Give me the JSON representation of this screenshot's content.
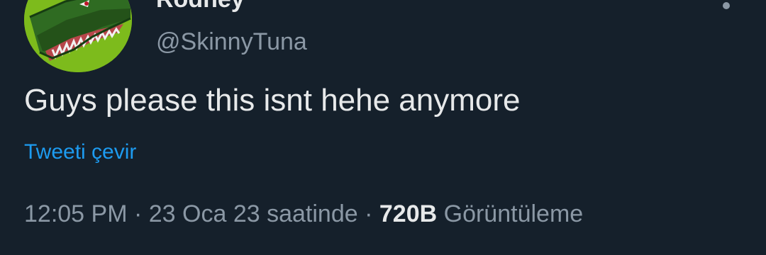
{
  "author": {
    "display_name": "Rodney",
    "handle": "@SkinnyTuna",
    "avatar_icon": "green-dinosaur-avatar"
  },
  "menu_icon": "more-options-icon",
  "tweet": {
    "text": "Guys please this isnt hehe anymore",
    "translate_label": "Tweeti çevir"
  },
  "meta": {
    "time": "12:05 PM",
    "separator": "·",
    "date_text": "23 Oca 23 saatinde",
    "views_count": "720B",
    "views_label": "Görüntüleme"
  },
  "colors": {
    "background": "#15202b",
    "primary_text": "#e7e9ea",
    "secondary_text": "#8b98a5",
    "link": "#1d9bf0",
    "avatar_green": "#7dbb1c"
  }
}
